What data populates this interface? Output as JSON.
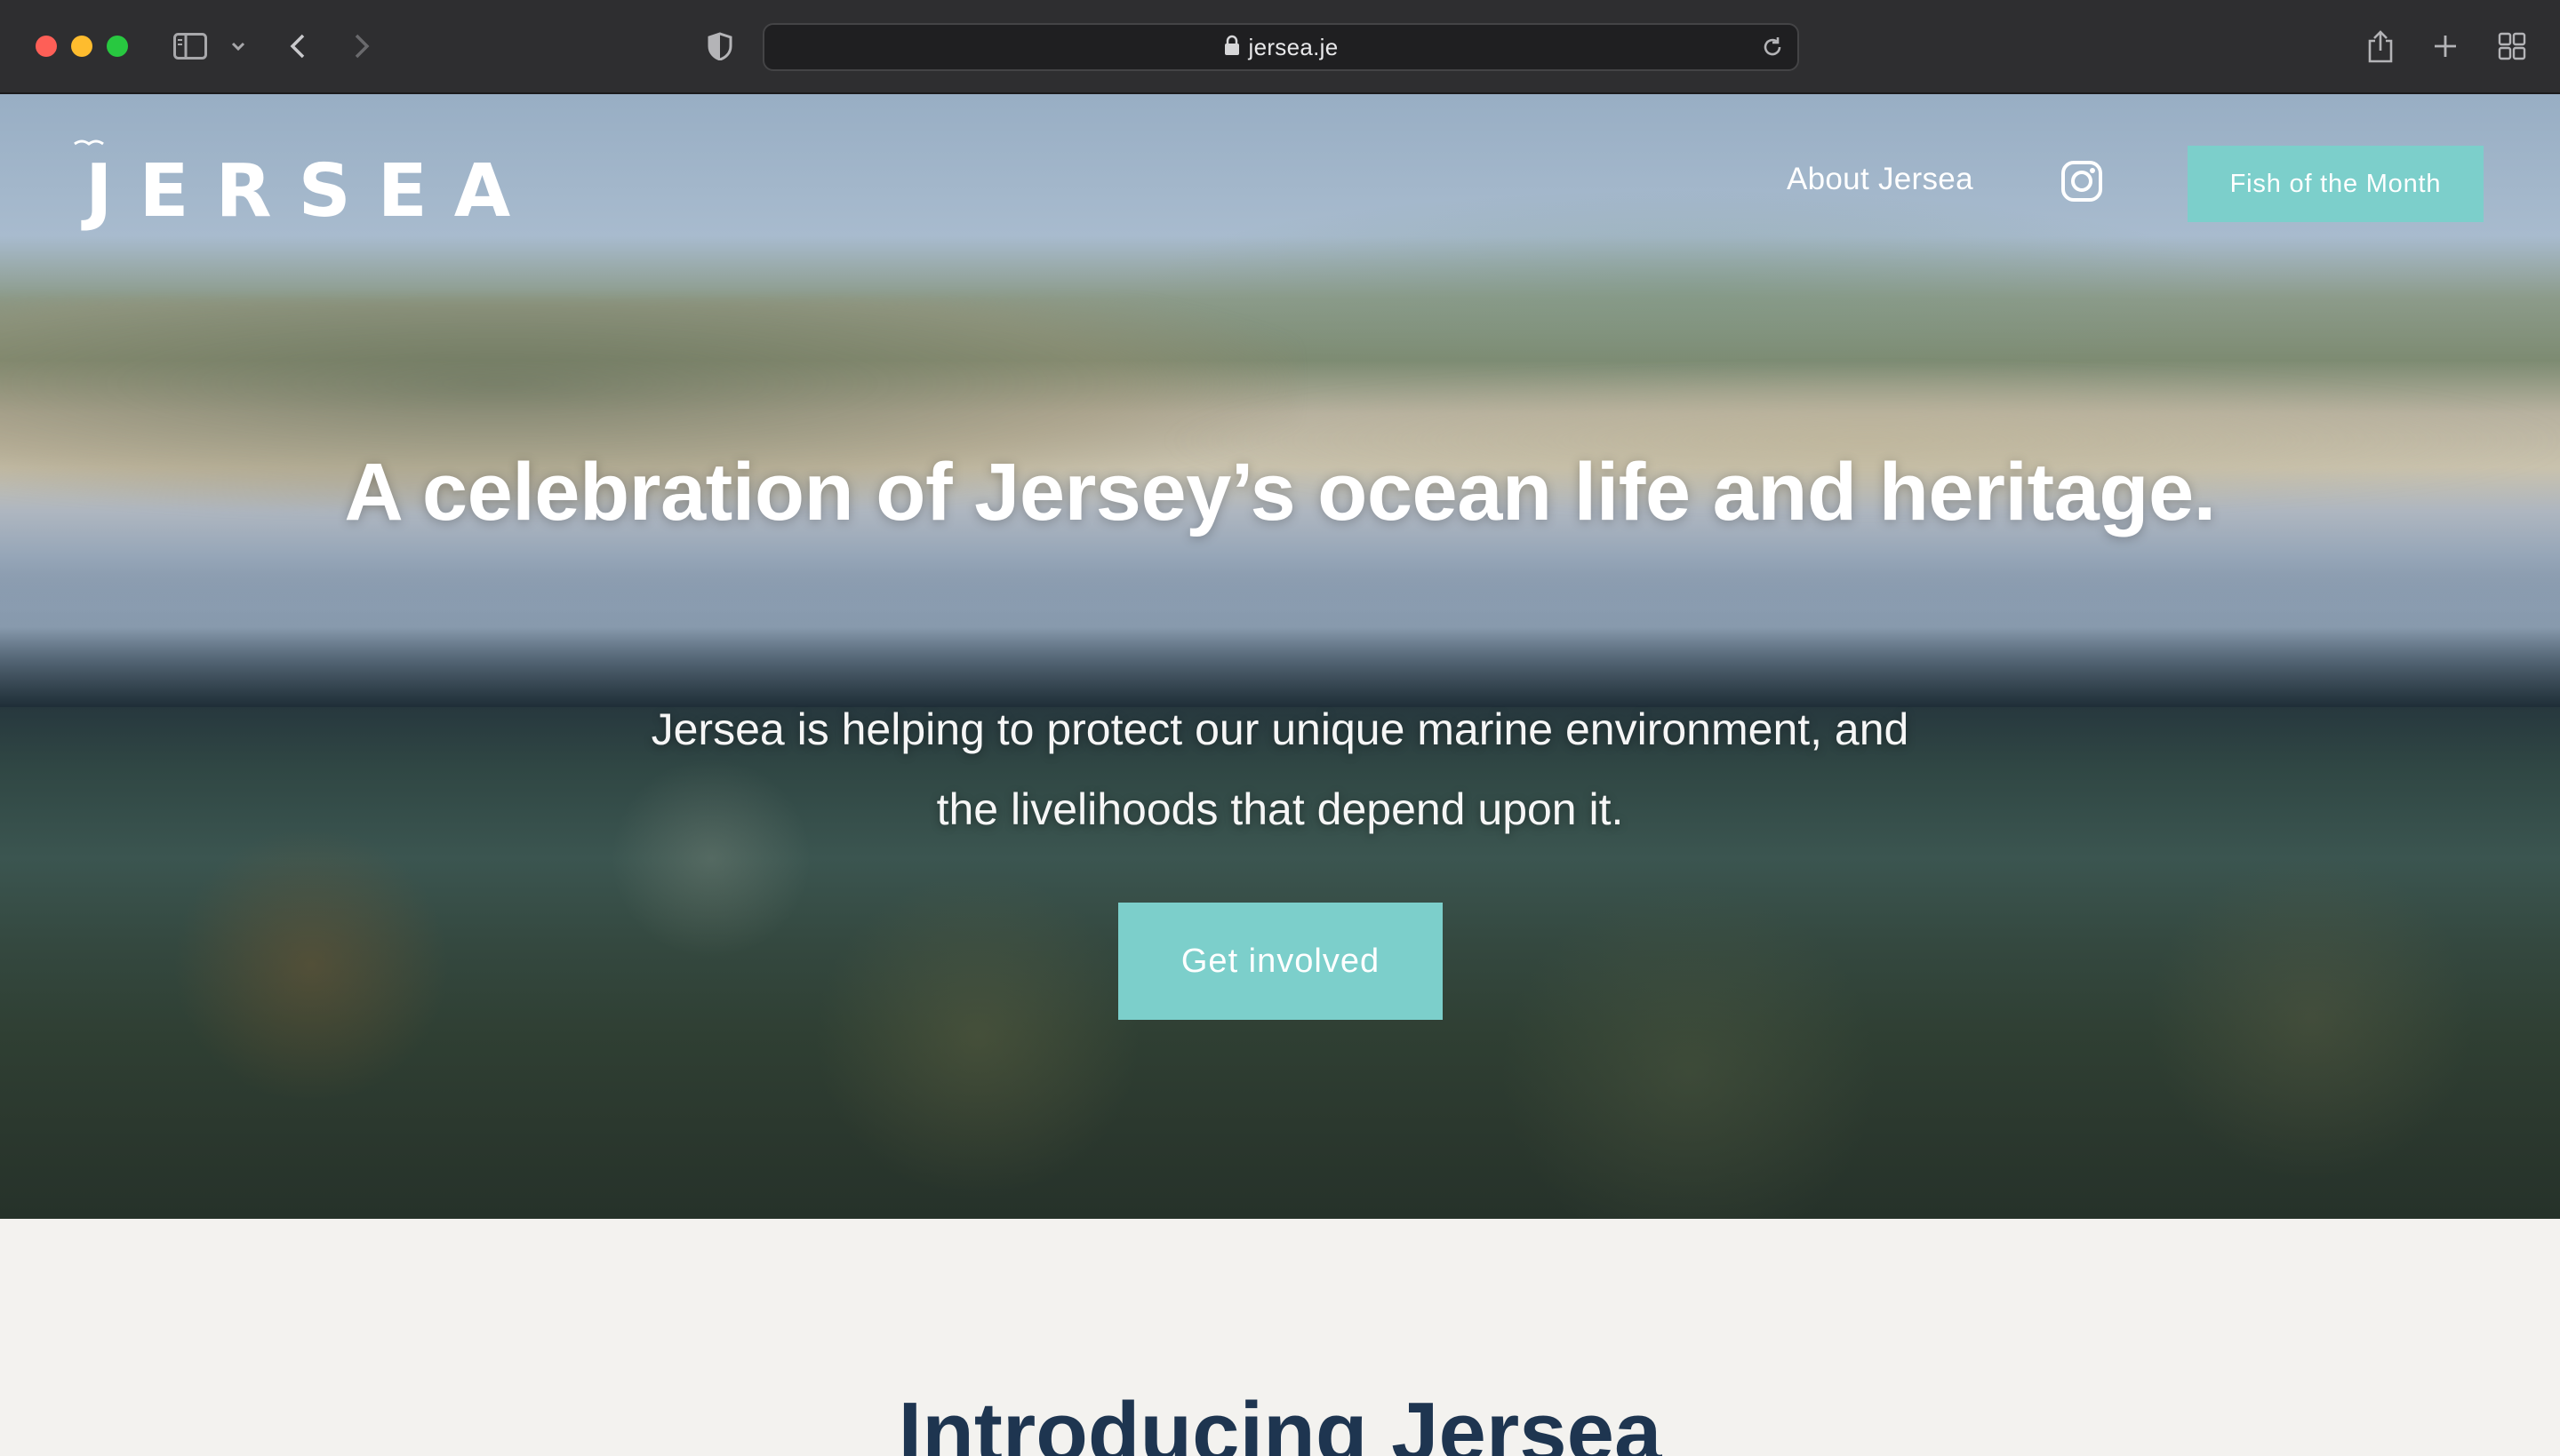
{
  "browser": {
    "url": "jersea.je",
    "icons": [
      "sidebar-icon",
      "chevron-down-icon",
      "back-icon",
      "forward-icon",
      "shield-icon",
      "lock-icon",
      "reload-icon",
      "share-icon",
      "new-tab-icon",
      "tab-overview-icon"
    ]
  },
  "site": {
    "logo_text": "JERSEA",
    "nav": {
      "about_label": "About Jersea",
      "instagram_icon": "instagram-icon",
      "cta_label": "Fish of the Month"
    }
  },
  "hero": {
    "title": "A celebration of Jersey’s ocean life and heritage.",
    "subtitle": "Jersea is helping to protect our unique marine environment, and the livelihoods that depend upon it.",
    "button_label": "Get involved"
  },
  "intro": {
    "heading": "Introducing Jersea"
  },
  "colors": {
    "accent": "#7ccfcb",
    "heading_navy": "#1e3550",
    "page_background": "#f3f2ef"
  }
}
